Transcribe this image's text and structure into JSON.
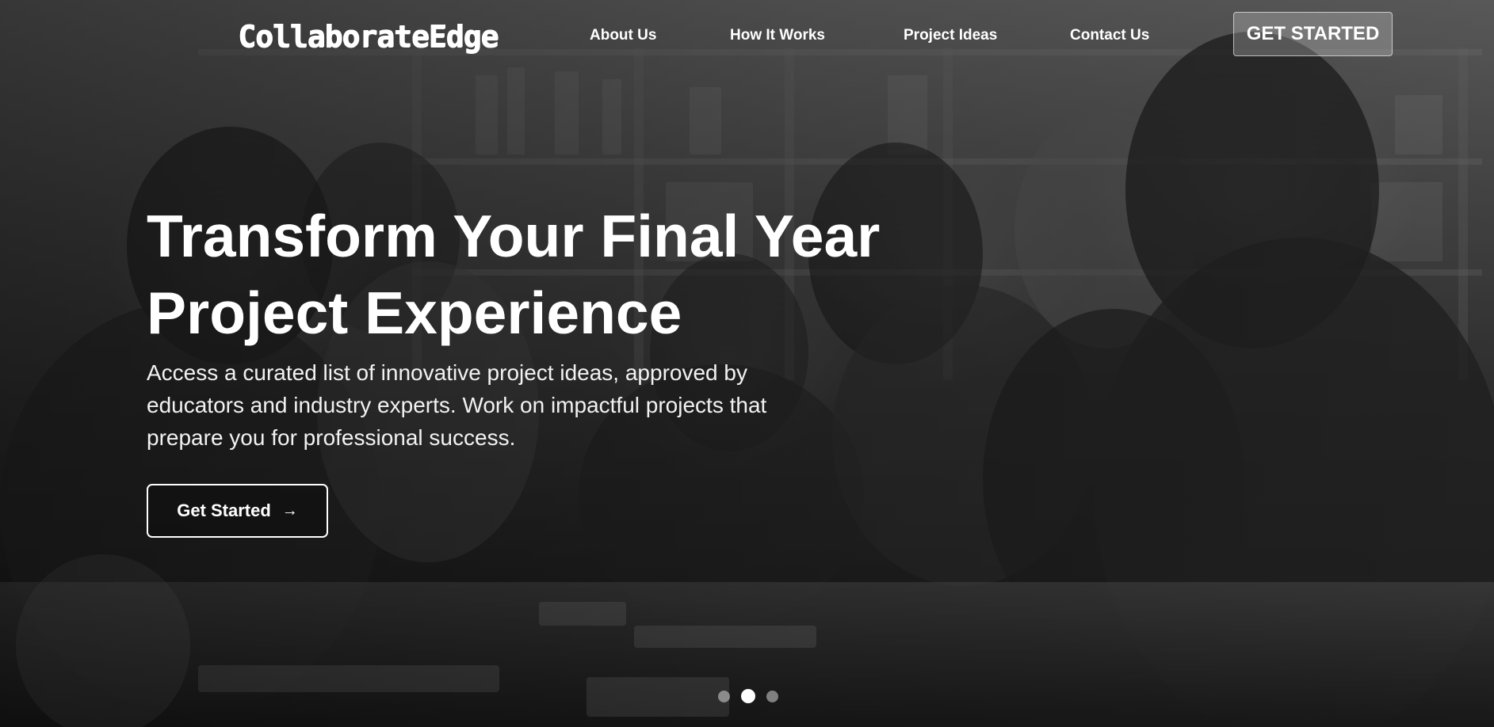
{
  "brand": {
    "logo_text": "CollaborateEdge"
  },
  "nav": {
    "links": [
      {
        "label": "About Us"
      },
      {
        "label": "How It Works"
      },
      {
        "label": "Project Ideas"
      },
      {
        "label": "Contact Us"
      }
    ],
    "cta_label": "GET STARTED"
  },
  "hero": {
    "headline_line1": "Transform Your Final Year",
    "headline_line2": "Project Experience",
    "subtitle": "Access a curated list of innovative project ideas, approved by educators and industry experts. Work on impactful projects that prepare you for professional success.",
    "cta_label": "Get Started",
    "cta_icon": "arrow-right-icon",
    "background": "grayscale photo of students collaborating around a table"
  },
  "carousel": {
    "slides": 3,
    "active_index": 1
  },
  "colors": {
    "text": "#ffffff",
    "overlay": "#000000"
  }
}
